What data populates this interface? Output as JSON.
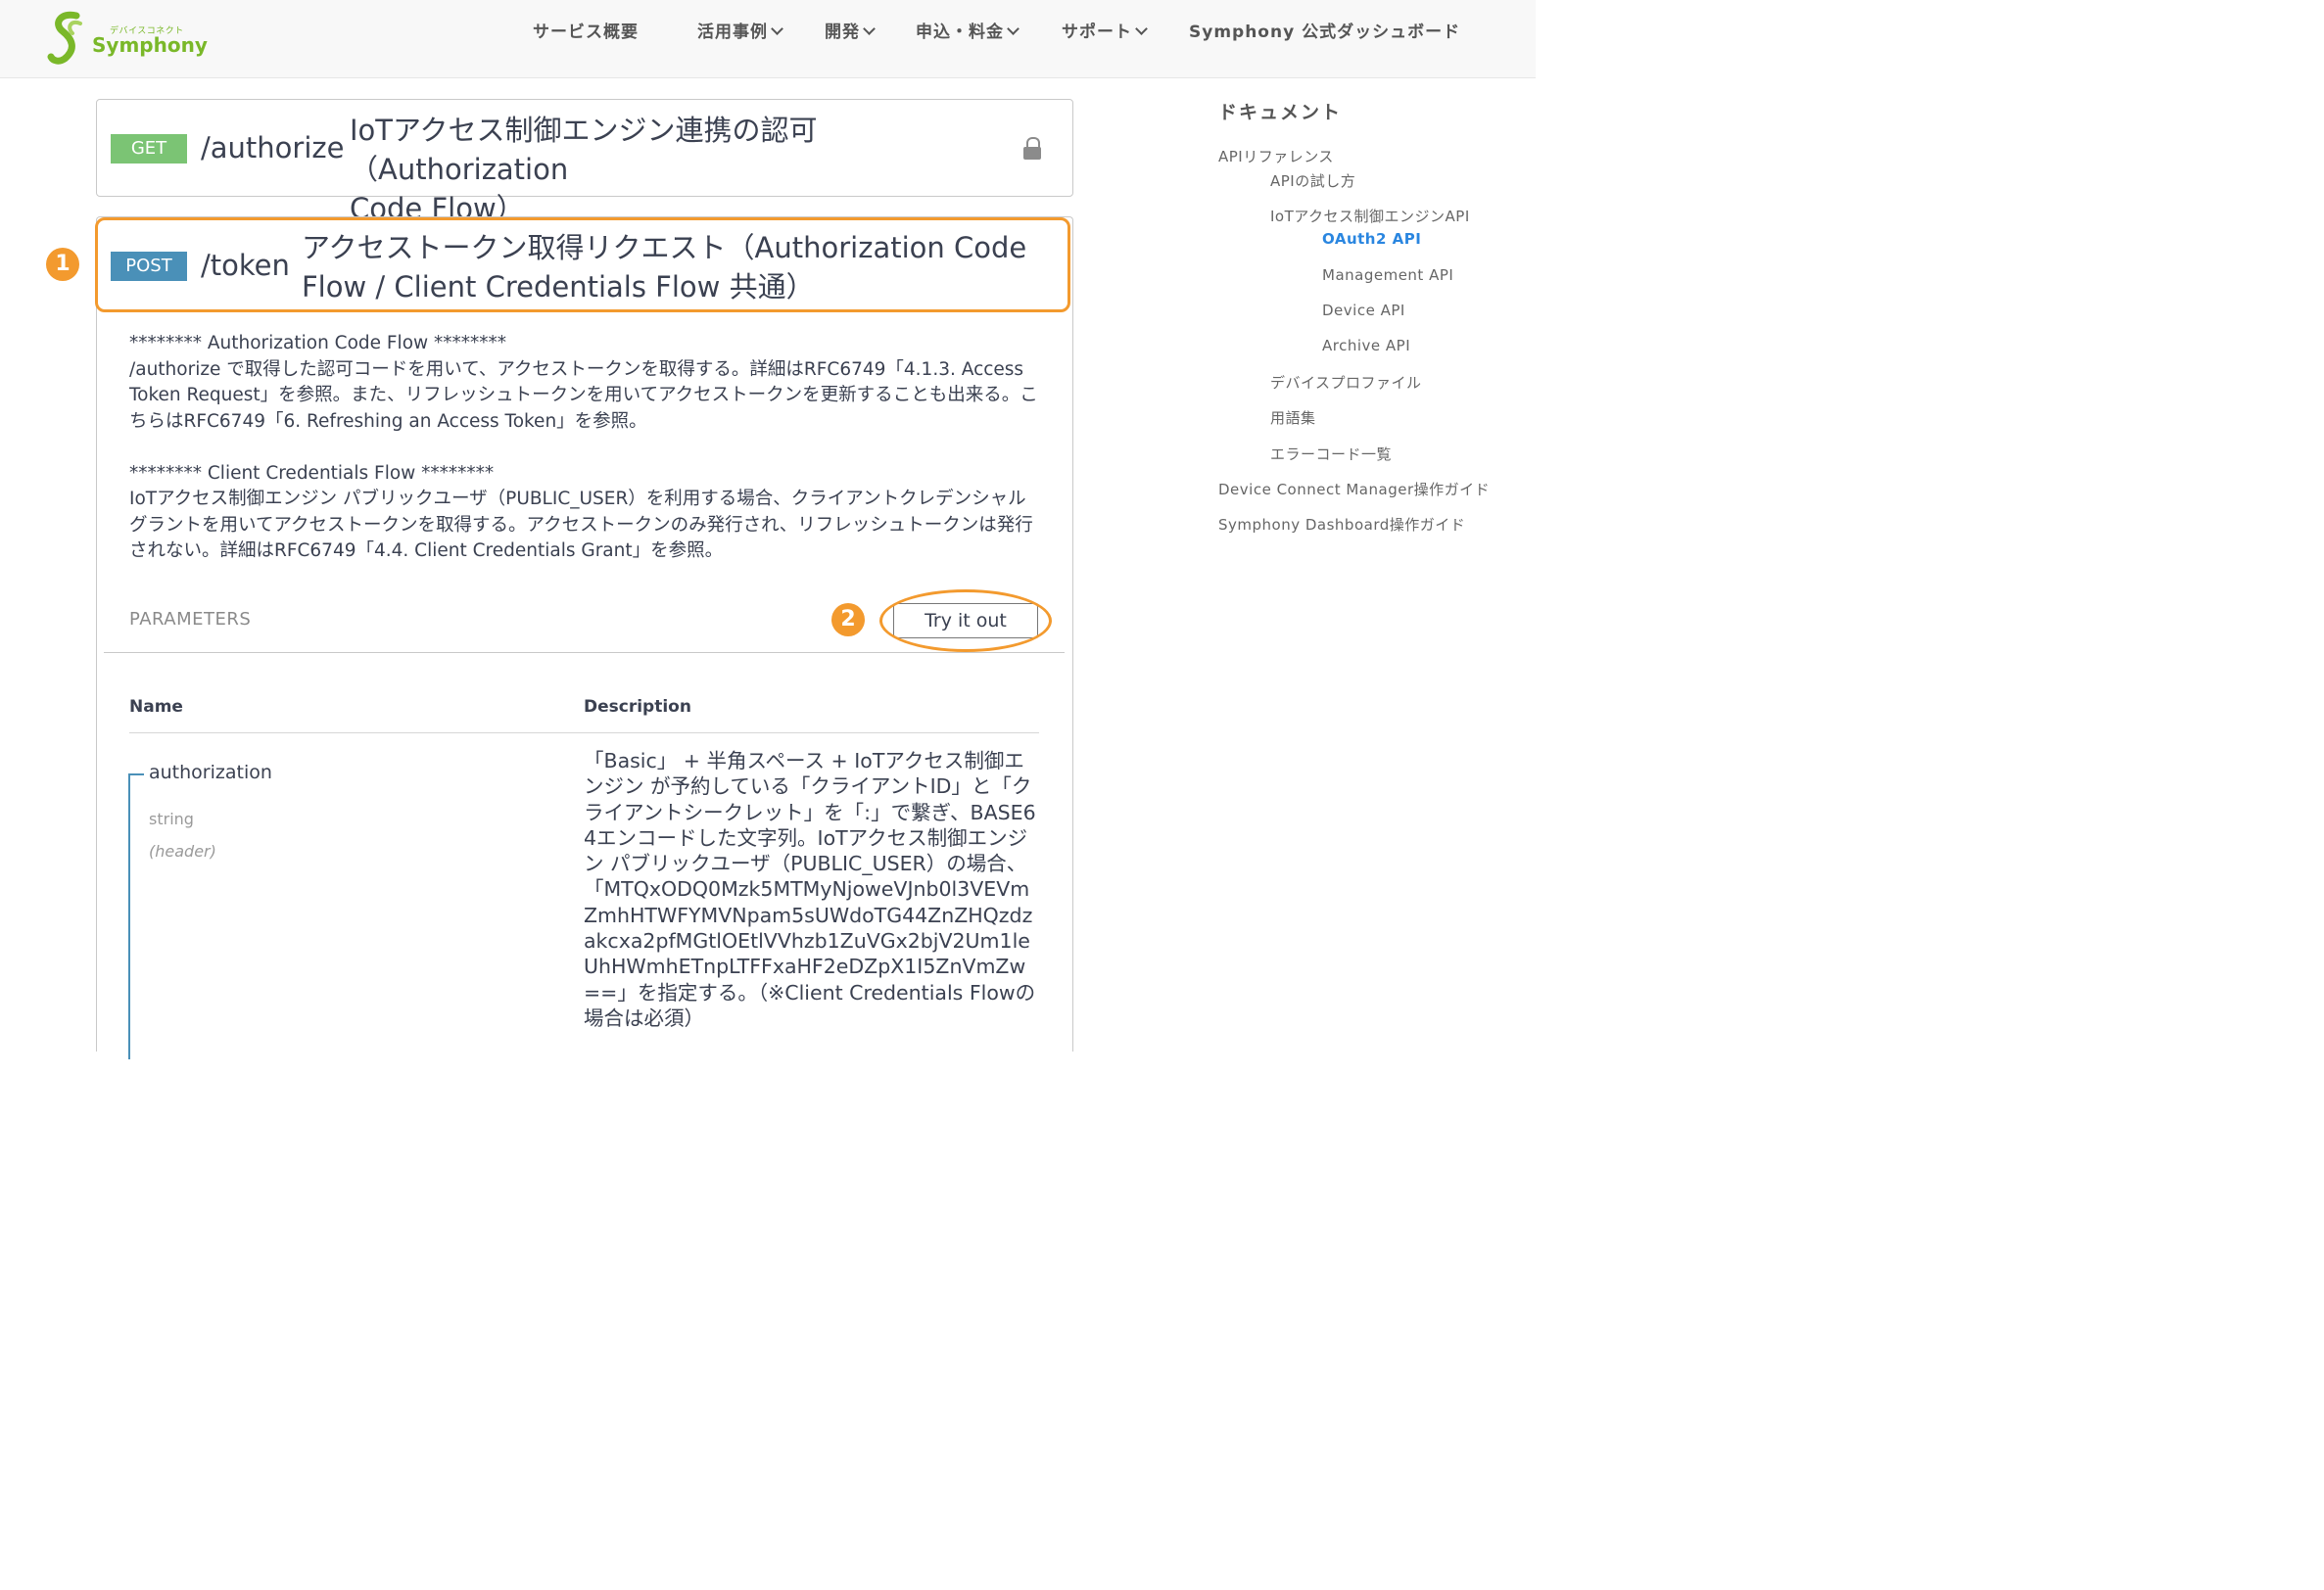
{
  "header": {
    "logo_small": "デバイスコネクト",
    "logo_text": "Symphony",
    "nav": [
      {
        "label": "サービス概要",
        "chevron": false
      },
      {
        "label": "活用事例",
        "chevron": true
      },
      {
        "label": "開発",
        "chevron": true
      },
      {
        "label": "申込・料金",
        "chevron": true
      },
      {
        "label": "サポート",
        "chevron": true
      },
      {
        "label": "Symphony 公式ダッシュボード",
        "chevron": false
      }
    ]
  },
  "get_op": {
    "method": "GET",
    "path": "/authorize",
    "summary_line1": "IoTアクセス制御エンジン連携の認可（Authorization",
    "summary_line2": "Code Flow）"
  },
  "post_op": {
    "method": "POST",
    "path": "/token",
    "summary_line1": "アクセストークン取得リクエスト（Authorization Code",
    "summary_line2": "Flow / Client Credentials Flow 共通）",
    "description": {
      "p1_title": "******** Authorization Code Flow ********",
      "p1_body": "/authorize で取得した認可コードを用いて、アクセストークンを取得する。詳細はRFC6749「4.1.3. Access Token Request」を参照。また、リフレッシュトークンを用いてアクセストークンを更新することも出来る。こちらはRFC6749「6. Refreshing an Access Token」を参照。",
      "p2_title": "******** Client Credentials Flow ********",
      "p2_body": "IoTアクセス制御エンジン パブリックユーザ（PUBLIC_USER）を利用する場合、クライアントクレデンシャルグラントを用いてアクセストークンを取得する。アクセストークンのみ発行され、リフレッシュトークンは発行されない。詳細はRFC6749「4.4. Client Credentials Grant」を参照。"
    },
    "parameters_label": "PARAMETERS",
    "try_it_out": "Try it out",
    "table": {
      "col_name": "Name",
      "col_description": "Description"
    },
    "param": {
      "name": "authorization",
      "type": "string",
      "in": "(header)",
      "description": "「Basic」 + 半角スペース + IoTアクセス制御エンジン が予約している「クライアントID」と「クライアントシークレット」を「:」で繋ぎ、BASE64エンコードした文字列。IoTアクセス制御エンジン パブリックユーザ（PUBLIC_USER）の場合、「MTQxODQ0Mzk5MTMyNjoweVJnb0l3VEVmZmhHTWFYMVNpam5sUWdoTG44ZnZHQzdzakcxa2pfMGtlOEtlVVhzb1ZuVGx2bjV2Um1leUhHWmhETnpLTFFxaHF2eDZpX1I5ZnVmZw==」を指定する。（※Client Credentials Flowの場合は必須）"
    }
  },
  "annotations": {
    "badge1": "1",
    "badge2": "2",
    "highlight_color": "#f39a2e"
  },
  "sidebar": {
    "title": "ドキュメント",
    "items": [
      {
        "label": "APIリファレンス",
        "active": false
      },
      {
        "label": "APIの試し方",
        "active": false
      },
      {
        "label": "IoTアクセス制御エンジンAPI",
        "active": false
      },
      {
        "label": "OAuth2 API",
        "active": true
      },
      {
        "label": "Management API",
        "active": false
      },
      {
        "label": "Device API",
        "active": false
      },
      {
        "label": "Archive API",
        "active": false
      },
      {
        "label": "デバイスプロファイル",
        "active": false
      },
      {
        "label": "用語集",
        "active": false
      },
      {
        "label": "エラーコード一覧",
        "active": false
      },
      {
        "label": "Device Connect Manager操作ガイド",
        "active": false
      },
      {
        "label": "Symphony Dashboard操作ガイド",
        "active": false
      }
    ]
  },
  "colors": {
    "get": "#7bc474",
    "post": "#4a90b8",
    "accent": "#f39a2e",
    "active_link": "#2a86e0",
    "logo": "#7ab829"
  }
}
